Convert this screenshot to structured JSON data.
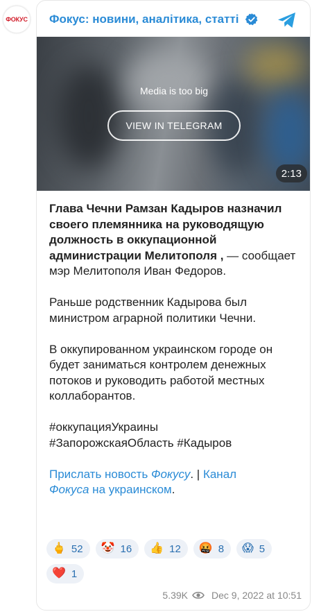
{
  "channel": {
    "avatar_text": "ФОКУС",
    "title": "Фокус: новини, аналітика, статті",
    "icons": [
      "verified-icon",
      "telegram-icon"
    ]
  },
  "media": {
    "message": "Media is too big",
    "button_label": "VIEW IN TELEGRAM",
    "duration": "2:13"
  },
  "post": {
    "bold_text": "Глава Чечни Рамзан Кадыров назначил своего племянника на руководящую должность в оккупационной администрации Мелитополя ,",
    "bold_tail": " — сообщает мэр Мелитополя Иван Федоров.",
    "paragraph2": "Раньше родственник Кадырова был министром аграрной политики Чечни.",
    "paragraph3": "В оккупированном украинском городе он будет заниматься контролем денежных потоков и руководить работой местных коллаборантов.",
    "hashtags_line1": "#оккупацияУкраины",
    "hashtags_line2": "#ЗапорожскаяОбласть #Кадыров",
    "links": {
      "part1": "Прислать новость ",
      "part2": "Фокусу",
      "part3": ". | ",
      "part4": "Канал",
      "part5": "Фокуса",
      "part6": " на украинском",
      "part7": "."
    }
  },
  "reactions": [
    {
      "emoji": "🖕",
      "count": "52"
    },
    {
      "emoji": "🤡",
      "count": "16"
    },
    {
      "emoji": "👍",
      "count": "12"
    },
    {
      "emoji": "🤬",
      "count": "8"
    },
    {
      "emoji": "😱",
      "count": "5"
    },
    {
      "emoji": "❤️",
      "count": "1"
    }
  ],
  "footer": {
    "views": "5.39K",
    "date": "Dec 9, 2022 at 10:51"
  },
  "colors": {
    "accent": "#2a8bd6",
    "reaction_bg": "#edf1f7",
    "logo_red": "#d21e2b"
  }
}
